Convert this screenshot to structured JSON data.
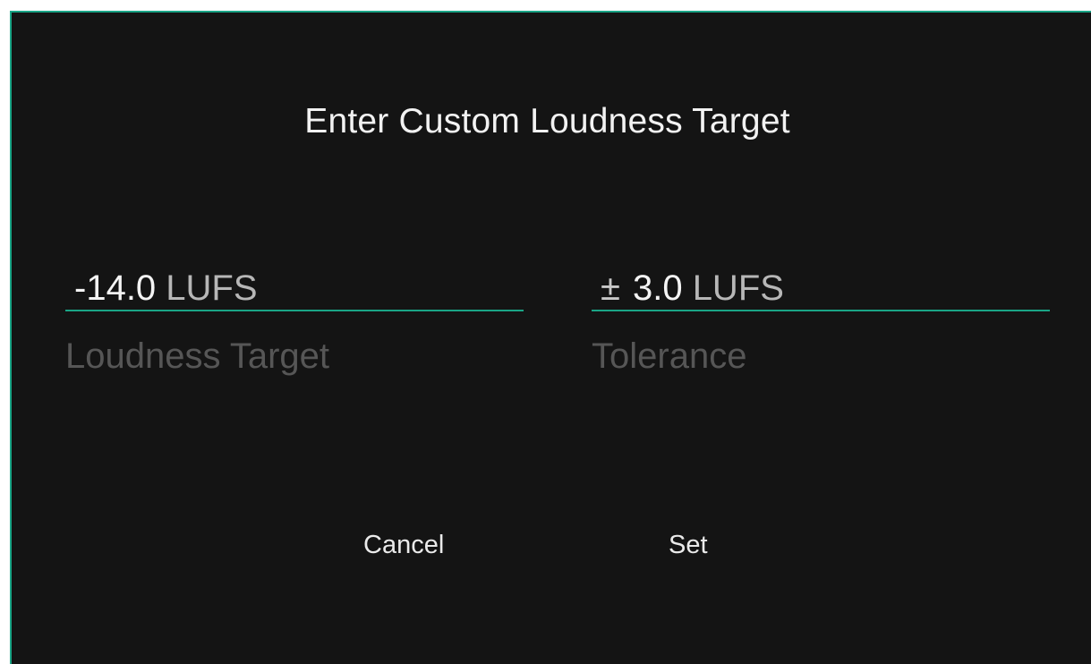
{
  "dialog": {
    "title": "Enter Custom Loudness Target",
    "accent_color": "#1aa586",
    "background_color": "#141414"
  },
  "loudness_target": {
    "value": "-14.0",
    "unit": "LUFS",
    "label": "Loudness Target"
  },
  "tolerance": {
    "prefix": "±",
    "value": "3.0",
    "unit": "LUFS",
    "label": "Tolerance"
  },
  "buttons": {
    "cancel_label": "Cancel",
    "set_label": "Set"
  }
}
